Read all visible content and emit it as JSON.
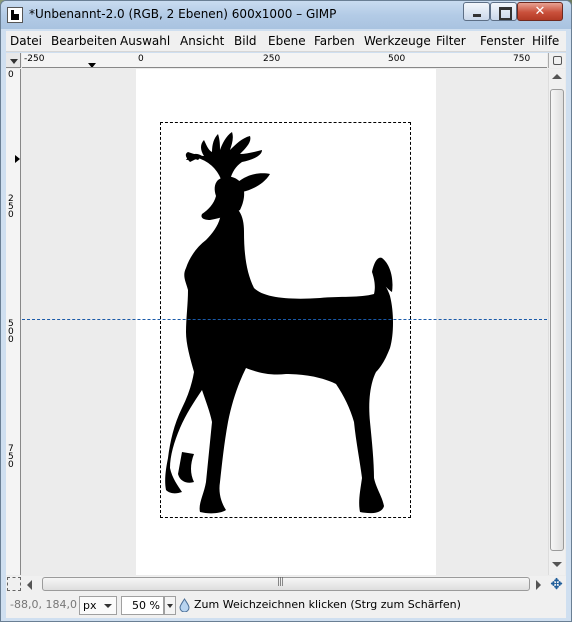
{
  "window": {
    "title": "*Unbenannt-2.0 (RGB, 2 Ebenen) 600x1000 – GIMP",
    "close_label": "✕"
  },
  "menubar": {
    "items": [
      {
        "label": "Datei"
      },
      {
        "label": "Bearbeiten"
      },
      {
        "label": "Auswahl"
      },
      {
        "label": "Ansicht"
      },
      {
        "label": "Bild"
      },
      {
        "label": "Ebene"
      },
      {
        "label": "Farben"
      },
      {
        "label": "Werkzeuge"
      },
      {
        "label": "Filter"
      },
      {
        "label": "Fenster"
      },
      {
        "label": "Hilfe"
      }
    ]
  },
  "rulers": {
    "horizontal_labels": [
      "-250",
      "0",
      "250",
      "500",
      "750"
    ],
    "vertical_labels": [
      "0",
      "250",
      "500",
      "750"
    ]
  },
  "canvas": {
    "image_color": "#ffffff",
    "silhouette": "deer",
    "silhouette_color": "#000000",
    "guide_color": "#1a5aa8"
  },
  "statusbar": {
    "coordinates": "-88,0, 184,0",
    "unit": "px",
    "zoom": "50 %",
    "message": "Zum Weichzeichnen klicken (Strg zum Schärfen)"
  },
  "icons": {
    "app": "gimp-icon",
    "tool": "blur-drop-icon",
    "navigate": "navigate-icon"
  }
}
